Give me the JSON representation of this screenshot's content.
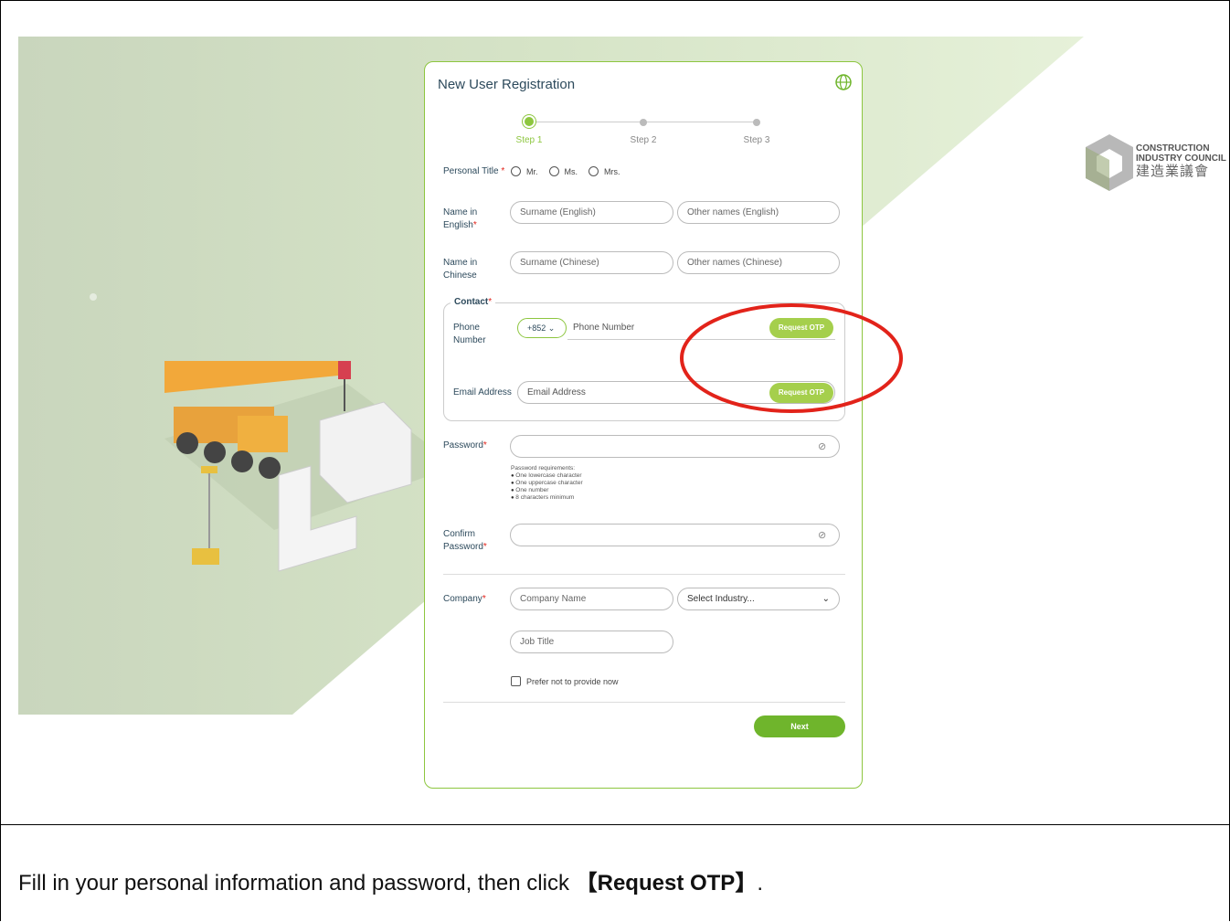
{
  "form": {
    "title": "New User Registration",
    "steps": [
      "Step 1",
      "Step 2",
      "Step 3"
    ],
    "active_step": 1,
    "personal_title": {
      "label": "Personal Title",
      "required_mark": "*",
      "options": [
        "Mr.",
        "Ms.",
        "Mrs."
      ]
    },
    "name_english": {
      "label_line1": "Name in",
      "label_line2": "English",
      "required_mark": "*",
      "surname_placeholder": "Surname (English)",
      "other_placeholder": "Other names (English)"
    },
    "name_chinese": {
      "label_line1": "Name in",
      "label_line2": "Chinese",
      "surname_placeholder": "Surname (Chinese)",
      "other_placeholder": "Other names (Chinese)"
    },
    "contact": {
      "legend": "Contact",
      "required_mark": "*",
      "phone_label_line1": "Phone",
      "phone_label_line2": "Number",
      "country_code": "+852",
      "phone_placeholder": "Phone Number",
      "phone_otp_label": "Request OTP",
      "email_label": "Email Address",
      "email_placeholder": "Email Address",
      "email_otp_label": "Request OTP"
    },
    "password": {
      "label": "Password",
      "required_mark": "*",
      "requirements_title": "Password requirements:",
      "requirements": [
        "One lowercase character",
        "One uppercase character",
        "One number",
        "8 characters minimum"
      ]
    },
    "confirm_password": {
      "label_line1": "Confirm",
      "label_line2": "Password",
      "required_mark": "*"
    },
    "company": {
      "label": "Company",
      "required_mark": "*",
      "name_placeholder": "Company Name",
      "industry_selected": "Select Industry...",
      "job_title_placeholder": "Job Title",
      "prefer_not_label": "Prefer not to provide now"
    },
    "next_label": "Next"
  },
  "brand": {
    "line1": "CONSTRUCTION",
    "line2": "INDUSTRY COUNCIL",
    "line3": "建造業議會"
  },
  "caption": {
    "before": "Fill in your personal information and password, then click ",
    "bold": "【Request OTP】",
    "after": "."
  },
  "colors": {
    "accent": "#8dc63f",
    "button": "#a5cf4c",
    "annotation": "#e2231a"
  }
}
